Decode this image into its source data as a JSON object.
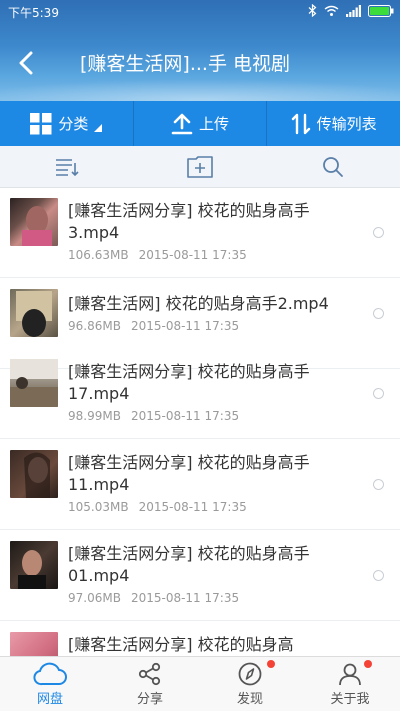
{
  "status": {
    "time": "下午5:39"
  },
  "header": {
    "title": "[赚客生活网]...手 电视剧"
  },
  "actions": [
    {
      "label": "分类"
    },
    {
      "label": "上传"
    },
    {
      "label": "传输列表"
    }
  ],
  "files": [
    {
      "name": "[赚客生活网分享] 校花的贴身高手3.mp4",
      "size": "106.63MB",
      "date": "2015-08-11  17:35"
    },
    {
      "name": "[赚客生活网] 校花的贴身高手2.mp4",
      "size": "96.86MB",
      "date": "2015-08-11  17:35"
    },
    {
      "name": "[赚客生活网分享] 校花的贴身高手17.mp4",
      "size": "98.99MB",
      "date": "2015-08-11  17:35"
    },
    {
      "name": "[赚客生活网分享] 校花的贴身高手11.mp4",
      "size": "105.03MB",
      "date": "2015-08-11  17:35"
    },
    {
      "name": "[赚客生活网分享] 校花的贴身高手01.mp4",
      "size": "97.06MB",
      "date": "2015-08-11  17:35"
    },
    {
      "name": "[赚客生活网分享] 校花的贴身高",
      "size": "",
      "date": ""
    }
  ],
  "nav": [
    {
      "label": "网盘"
    },
    {
      "label": "分享"
    },
    {
      "label": "发现"
    },
    {
      "label": "关于我"
    }
  ],
  "colors": {
    "accent": "#1e88e5",
    "badge": "#f44336"
  }
}
